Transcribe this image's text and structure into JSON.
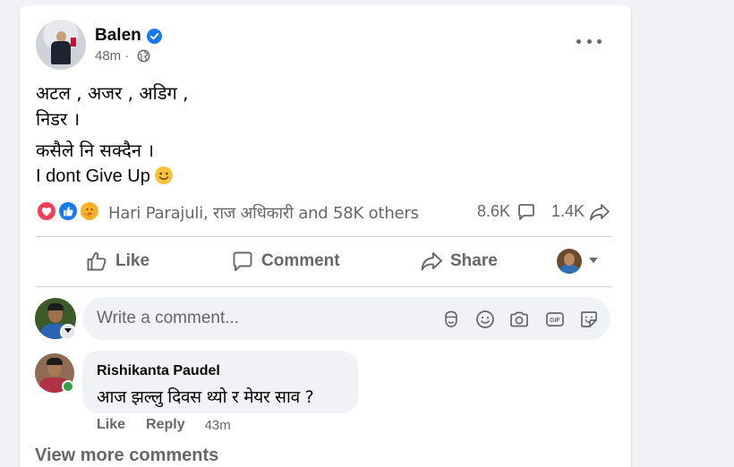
{
  "post": {
    "author": "Balen",
    "time": "48m",
    "time_separator": "·",
    "text_lines": [
      "अटल , अजर , अडिग ,",
      "निडर ।",
      "कसैले नि सक्दैन ।",
      "I dont Give Up"
    ],
    "emoji": "slightly-smiling-face",
    "reactions": {
      "types": [
        "love",
        "like",
        "care"
      ],
      "reactors_text": "Hari Parajuli, राज अधिकारी and 58K others",
      "comment_count": "8.6K",
      "share_count": "1.4K"
    }
  },
  "actions": {
    "like": "Like",
    "comment": "Comment",
    "share": "Share"
  },
  "composer": {
    "placeholder": "Write a comment..."
  },
  "comments": [
    {
      "author": "Rishikanta Paudel",
      "text": "आज झल्लु दिवस थ्यो र मेयर साव ?",
      "like": "Like",
      "reply": "Reply",
      "time": "43m"
    }
  ],
  "view_more": "View more comments",
  "colors": {
    "brand_blue": "#1877f2",
    "secondary_text": "#65676b",
    "online_green": "#31a24c",
    "love_red": "#f33e58",
    "care_yellow": "#f7b125"
  }
}
